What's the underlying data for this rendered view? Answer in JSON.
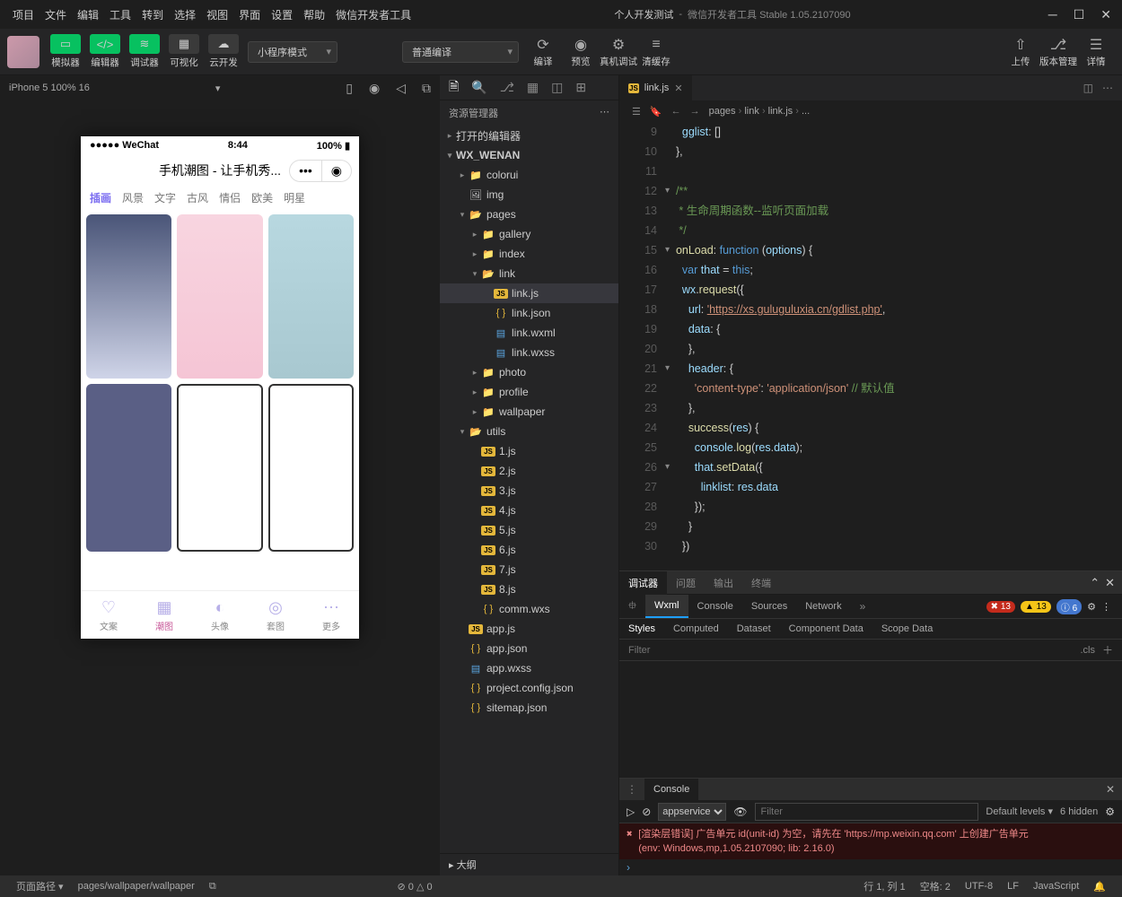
{
  "window": {
    "project": "个人开发测试",
    "product": "微信开发者工具 Stable 1.05.2107090"
  },
  "menu": [
    "项目",
    "文件",
    "编辑",
    "工具",
    "转到",
    "选择",
    "视图",
    "界面",
    "设置",
    "帮助",
    "微信开发者工具"
  ],
  "toolbar": {
    "simulator": "模拟器",
    "editor": "编辑器",
    "debugger": "调试器",
    "visual": "可视化",
    "cloud": "云开发",
    "mode": "小程序模式",
    "compile_mode": "普通编译",
    "compile": "编译",
    "preview": "预览",
    "remote": "真机调试",
    "cache": "清缓存",
    "upload": "上传",
    "version": "版本管理",
    "details": "详情"
  },
  "sim": {
    "device": "iPhone 5 100% 16",
    "status_l": "●●●●● WeChat",
    "time": "8:44",
    "battery": "100%",
    "title": "手机潮图 - 让手机秀...",
    "cats": [
      "插画",
      "风景",
      "文字",
      "古风",
      "情侣",
      "欧美",
      "明星"
    ],
    "tabs": [
      "文案",
      "潮图",
      "头像",
      "套图",
      "更多"
    ]
  },
  "explorer": {
    "title": "资源管理器",
    "open_editors": "打开的编辑器",
    "project": "WX_WENAN",
    "outline": "大纲",
    "tree": [
      {
        "d": 1,
        "arrow": "▸",
        "ico": "folder",
        "name": "colorui"
      },
      {
        "d": 1,
        "arrow": "",
        "ico": "img",
        "name": "img"
      },
      {
        "d": 1,
        "arrow": "▾",
        "ico": "folder-o",
        "name": "pages"
      },
      {
        "d": 2,
        "arrow": "▸",
        "ico": "folder",
        "name": "gallery"
      },
      {
        "d": 2,
        "arrow": "▸",
        "ico": "folder",
        "name": "index"
      },
      {
        "d": 2,
        "arrow": "▾",
        "ico": "folder-o",
        "name": "link"
      },
      {
        "d": 3,
        "arrow": "",
        "ico": "js",
        "name": "link.js",
        "sel": true
      },
      {
        "d": 3,
        "arrow": "",
        "ico": "json",
        "name": "link.json"
      },
      {
        "d": 3,
        "arrow": "",
        "ico": "wxml",
        "name": "link.wxml"
      },
      {
        "d": 3,
        "arrow": "",
        "ico": "wxss",
        "name": "link.wxss"
      },
      {
        "d": 2,
        "arrow": "▸",
        "ico": "folder",
        "name": "photo"
      },
      {
        "d": 2,
        "arrow": "▸",
        "ico": "folder",
        "name": "profile"
      },
      {
        "d": 2,
        "arrow": "▸",
        "ico": "folder",
        "name": "wallpaper"
      },
      {
        "d": 1,
        "arrow": "▾",
        "ico": "folder-o",
        "name": "utils"
      },
      {
        "d": 2,
        "arrow": "",
        "ico": "js",
        "name": "1.js"
      },
      {
        "d": 2,
        "arrow": "",
        "ico": "js",
        "name": "2.js"
      },
      {
        "d": 2,
        "arrow": "",
        "ico": "js",
        "name": "3.js"
      },
      {
        "d": 2,
        "arrow": "",
        "ico": "js",
        "name": "4.js"
      },
      {
        "d": 2,
        "arrow": "",
        "ico": "js",
        "name": "5.js"
      },
      {
        "d": 2,
        "arrow": "",
        "ico": "js",
        "name": "6.js"
      },
      {
        "d": 2,
        "arrow": "",
        "ico": "js",
        "name": "7.js"
      },
      {
        "d": 2,
        "arrow": "",
        "ico": "js",
        "name": "8.js"
      },
      {
        "d": 2,
        "arrow": "",
        "ico": "json",
        "name": "comm.wxs"
      },
      {
        "d": 1,
        "arrow": "",
        "ico": "js",
        "name": "app.js"
      },
      {
        "d": 1,
        "arrow": "",
        "ico": "json",
        "name": "app.json"
      },
      {
        "d": 1,
        "arrow": "",
        "ico": "wxss",
        "name": "app.wxss"
      },
      {
        "d": 1,
        "arrow": "",
        "ico": "json",
        "name": "project.config.json"
      },
      {
        "d": 1,
        "arrow": "",
        "ico": "json",
        "name": "sitemap.json"
      }
    ]
  },
  "editor": {
    "tab": "link.js",
    "crumbs": [
      "pages",
      "link",
      "link.js",
      "..."
    ],
    "lines_start": 9,
    "code": [
      {
        "html": "    <span class='c-var'>gglist</span><span class='c-pun'>: []</span>"
      },
      {
        "html": "  <span class='c-pun'>},</span>"
      },
      {
        "html": ""
      },
      {
        "html": "  <span class='c-green'>/**</span>",
        "fold": "▾"
      },
      {
        "html": "  <span class='c-green'> * 生命周期函数--监听页面加载</span>"
      },
      {
        "html": "  <span class='c-green'> */</span>"
      },
      {
        "html": "  <span class='c-fn'>onLoad</span><span class='c-pun'>: </span><span class='c-key'>function</span> <span class='c-pun'>(</span><span class='c-var'>options</span><span class='c-pun'>) {</span>",
        "fold": "▾"
      },
      {
        "html": "    <span class='c-key'>var</span> <span class='c-var'>that</span> <span class='c-pun'>=</span> <span class='c-key'>this</span><span class='c-pun'>;</span>"
      },
      {
        "html": "    <span class='c-var'>wx</span><span class='c-pun'>.</span><span class='c-fn'>request</span><span class='c-pun'>({</span>"
      },
      {
        "html": "      <span class='c-var'>url</span><span class='c-pun'>: </span><span class='c-str url'>'https://xs.guluguluxia.cn/gdlist.php'</span><span class='c-pun'>,</span>"
      },
      {
        "html": "      <span class='c-var'>data</span><span class='c-pun'>: {</span>"
      },
      {
        "html": "      <span class='c-pun'>},</span>"
      },
      {
        "html": "      <span class='c-var'>header</span><span class='c-pun'>: {</span>",
        "fold": "▾"
      },
      {
        "html": "        <span class='c-str'>'content-type'</span><span class='c-pun'>: </span><span class='c-str'>'application/json'</span> <span class='c-green'>// 默认值</span>"
      },
      {
        "html": "      <span class='c-pun'>},</span>"
      },
      {
        "html": "      <span class='c-fn'>success</span><span class='c-pun'>(</span><span class='c-var'>res</span><span class='c-pun'>) {</span>"
      },
      {
        "html": "        <span class='c-var'>console</span><span class='c-pun'>.</span><span class='c-fn'>log</span><span class='c-pun'>(</span><span class='c-var'>res</span><span class='c-pun'>.</span><span class='c-var'>data</span><span class='c-pun'>);</span>"
      },
      {
        "html": "        <span class='c-var'>that</span><span class='c-pun'>.</span><span class='c-fn'>setData</span><span class='c-pun'>({</span>",
        "fold": "▾"
      },
      {
        "html": "          <span class='c-var'>linklist</span><span class='c-pun'>: </span><span class='c-var'>res</span><span class='c-pun'>.</span><span class='c-var'>data</span>"
      },
      {
        "html": "        <span class='c-pun'>});</span>"
      },
      {
        "html": "      <span class='c-pun'>}</span>"
      },
      {
        "html": "    <span class='c-pun'>})</span>"
      }
    ]
  },
  "debugger": {
    "top_tabs": [
      "调试器",
      "问题",
      "输出",
      "终端"
    ],
    "tabs": [
      "Wxml",
      "Console",
      "Sources",
      "Network"
    ],
    "errs": "13",
    "warns": "13",
    "infos": "6",
    "styles_tabs": [
      "Styles",
      "Computed",
      "Dataset",
      "Component Data",
      "Scope Data"
    ],
    "filter_ph": "Filter",
    "cls": ".cls",
    "console": "Console",
    "ctx": "appservice",
    "levels": "Default levels",
    "hidden": "6 hidden",
    "err_line": "[渲染层错误] 广告单元 id(unit-id) 为空，请先在 'https://mp.weixin.qq.com' 上创建广告单元",
    "env_line": "(env: Windows,mp,1.05.2107090; lib: 2.16.0)"
  },
  "statusbar": {
    "route_label": "页面路径",
    "route": "pages/wallpaper/wallpaper",
    "diag": "⊘ 0 △ 0",
    "line": "行 1, 列 1",
    "spaces": "空格: 2",
    "enc": "UTF-8",
    "eol": "LF",
    "lang": "JavaScript"
  }
}
